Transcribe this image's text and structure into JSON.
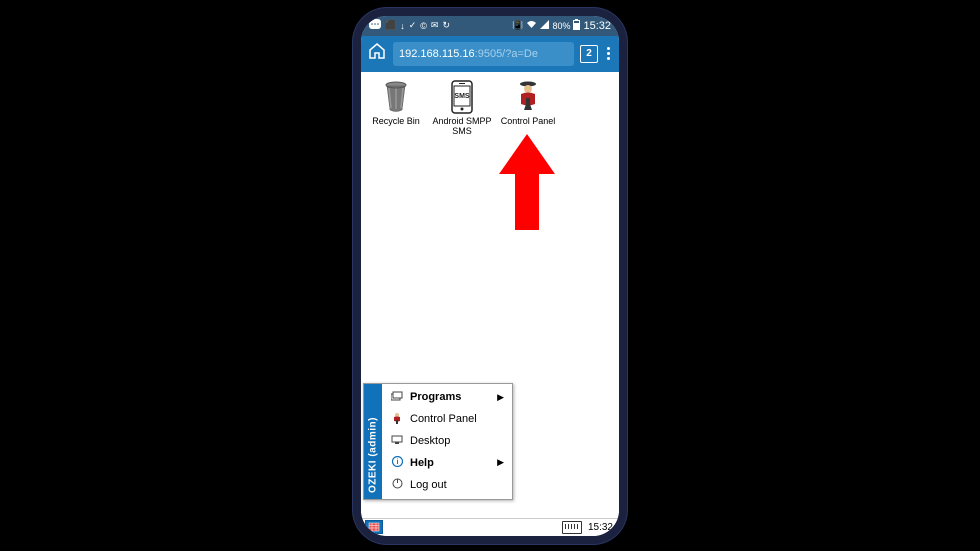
{
  "status": {
    "battery_pct": "80%",
    "time": "15:32"
  },
  "browser": {
    "url_host": "192.168.115.16",
    "url_rest": ":9505/?a=De",
    "tab_count": "2"
  },
  "desktop": {
    "icons": [
      {
        "label": "Recycle Bin",
        "icon": "trash"
      },
      {
        "label": "Android SMPP SMS",
        "icon": "sms"
      },
      {
        "label": "Control Panel",
        "icon": "admin"
      }
    ]
  },
  "start_menu": {
    "sidebar": "OZEKI (admin)",
    "items": [
      {
        "label": "Programs",
        "bold": true,
        "submenu": true,
        "icon": "programs"
      },
      {
        "label": "Control Panel",
        "bold": false,
        "submenu": false,
        "icon": "admin"
      },
      {
        "label": "Desktop",
        "bold": false,
        "submenu": false,
        "icon": "desktop"
      },
      {
        "label": "Help",
        "bold": true,
        "submenu": true,
        "icon": "help"
      },
      {
        "label": "Log out",
        "bold": false,
        "submenu": false,
        "icon": "logout"
      }
    ]
  },
  "taskbar": {
    "time": "15:32"
  }
}
